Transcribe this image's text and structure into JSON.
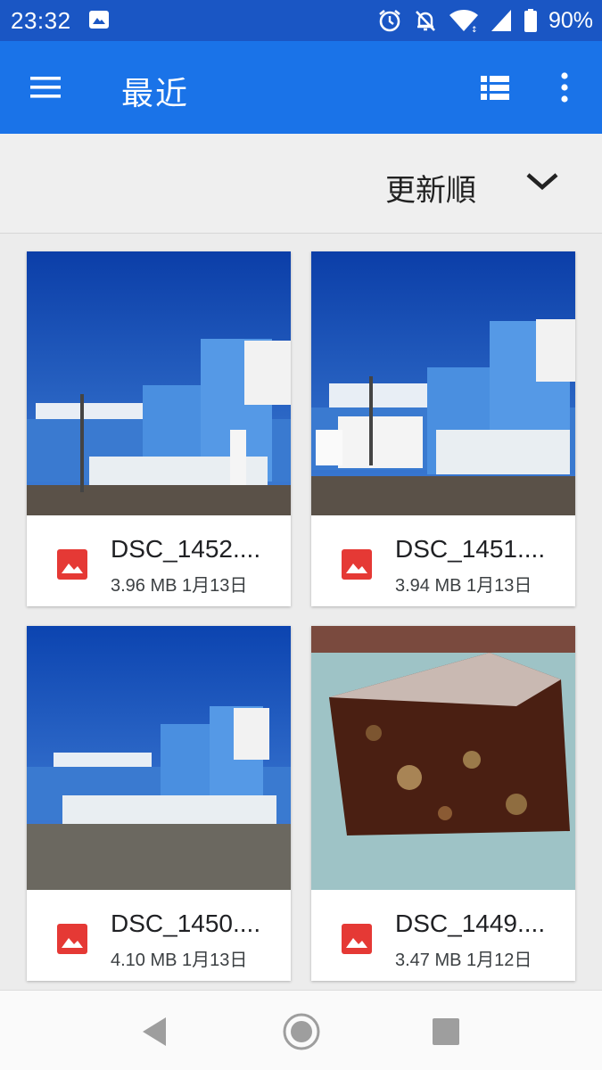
{
  "status_bar": {
    "time": "23:32",
    "battery": "90%",
    "icons": [
      "image-notification-icon",
      "alarm-icon",
      "notifications-off-icon",
      "wifi-icon",
      "signal-icon",
      "battery-icon"
    ]
  },
  "app_bar": {
    "title": "最近",
    "icons": [
      "menu-icon",
      "list-view-icon",
      "more-vert-icon"
    ]
  },
  "sort": {
    "label": "更新順",
    "icon": "chevron-down-icon"
  },
  "files": [
    {
      "name": "DSC_1452....",
      "size": "3.96 MB",
      "date": "1月13日",
      "icon": "image-file-icon"
    },
    {
      "name": "DSC_1451....",
      "size": "3.94 MB",
      "date": "1月13日",
      "icon": "image-file-icon"
    },
    {
      "name": "DSC_1450....",
      "size": "4.10 MB",
      "date": "1月13日",
      "icon": "image-file-icon"
    },
    {
      "name": "DSC_1449....",
      "size": "3.47 MB",
      "date": "1月12日",
      "icon": "image-file-icon"
    }
  ],
  "nav_bar": {
    "icons": [
      "back-icon",
      "home-icon",
      "recents-icon"
    ]
  },
  "colors": {
    "status_bar": "#1a56c4",
    "app_bar": "#1a73e8",
    "image_icon": "#e53935"
  }
}
